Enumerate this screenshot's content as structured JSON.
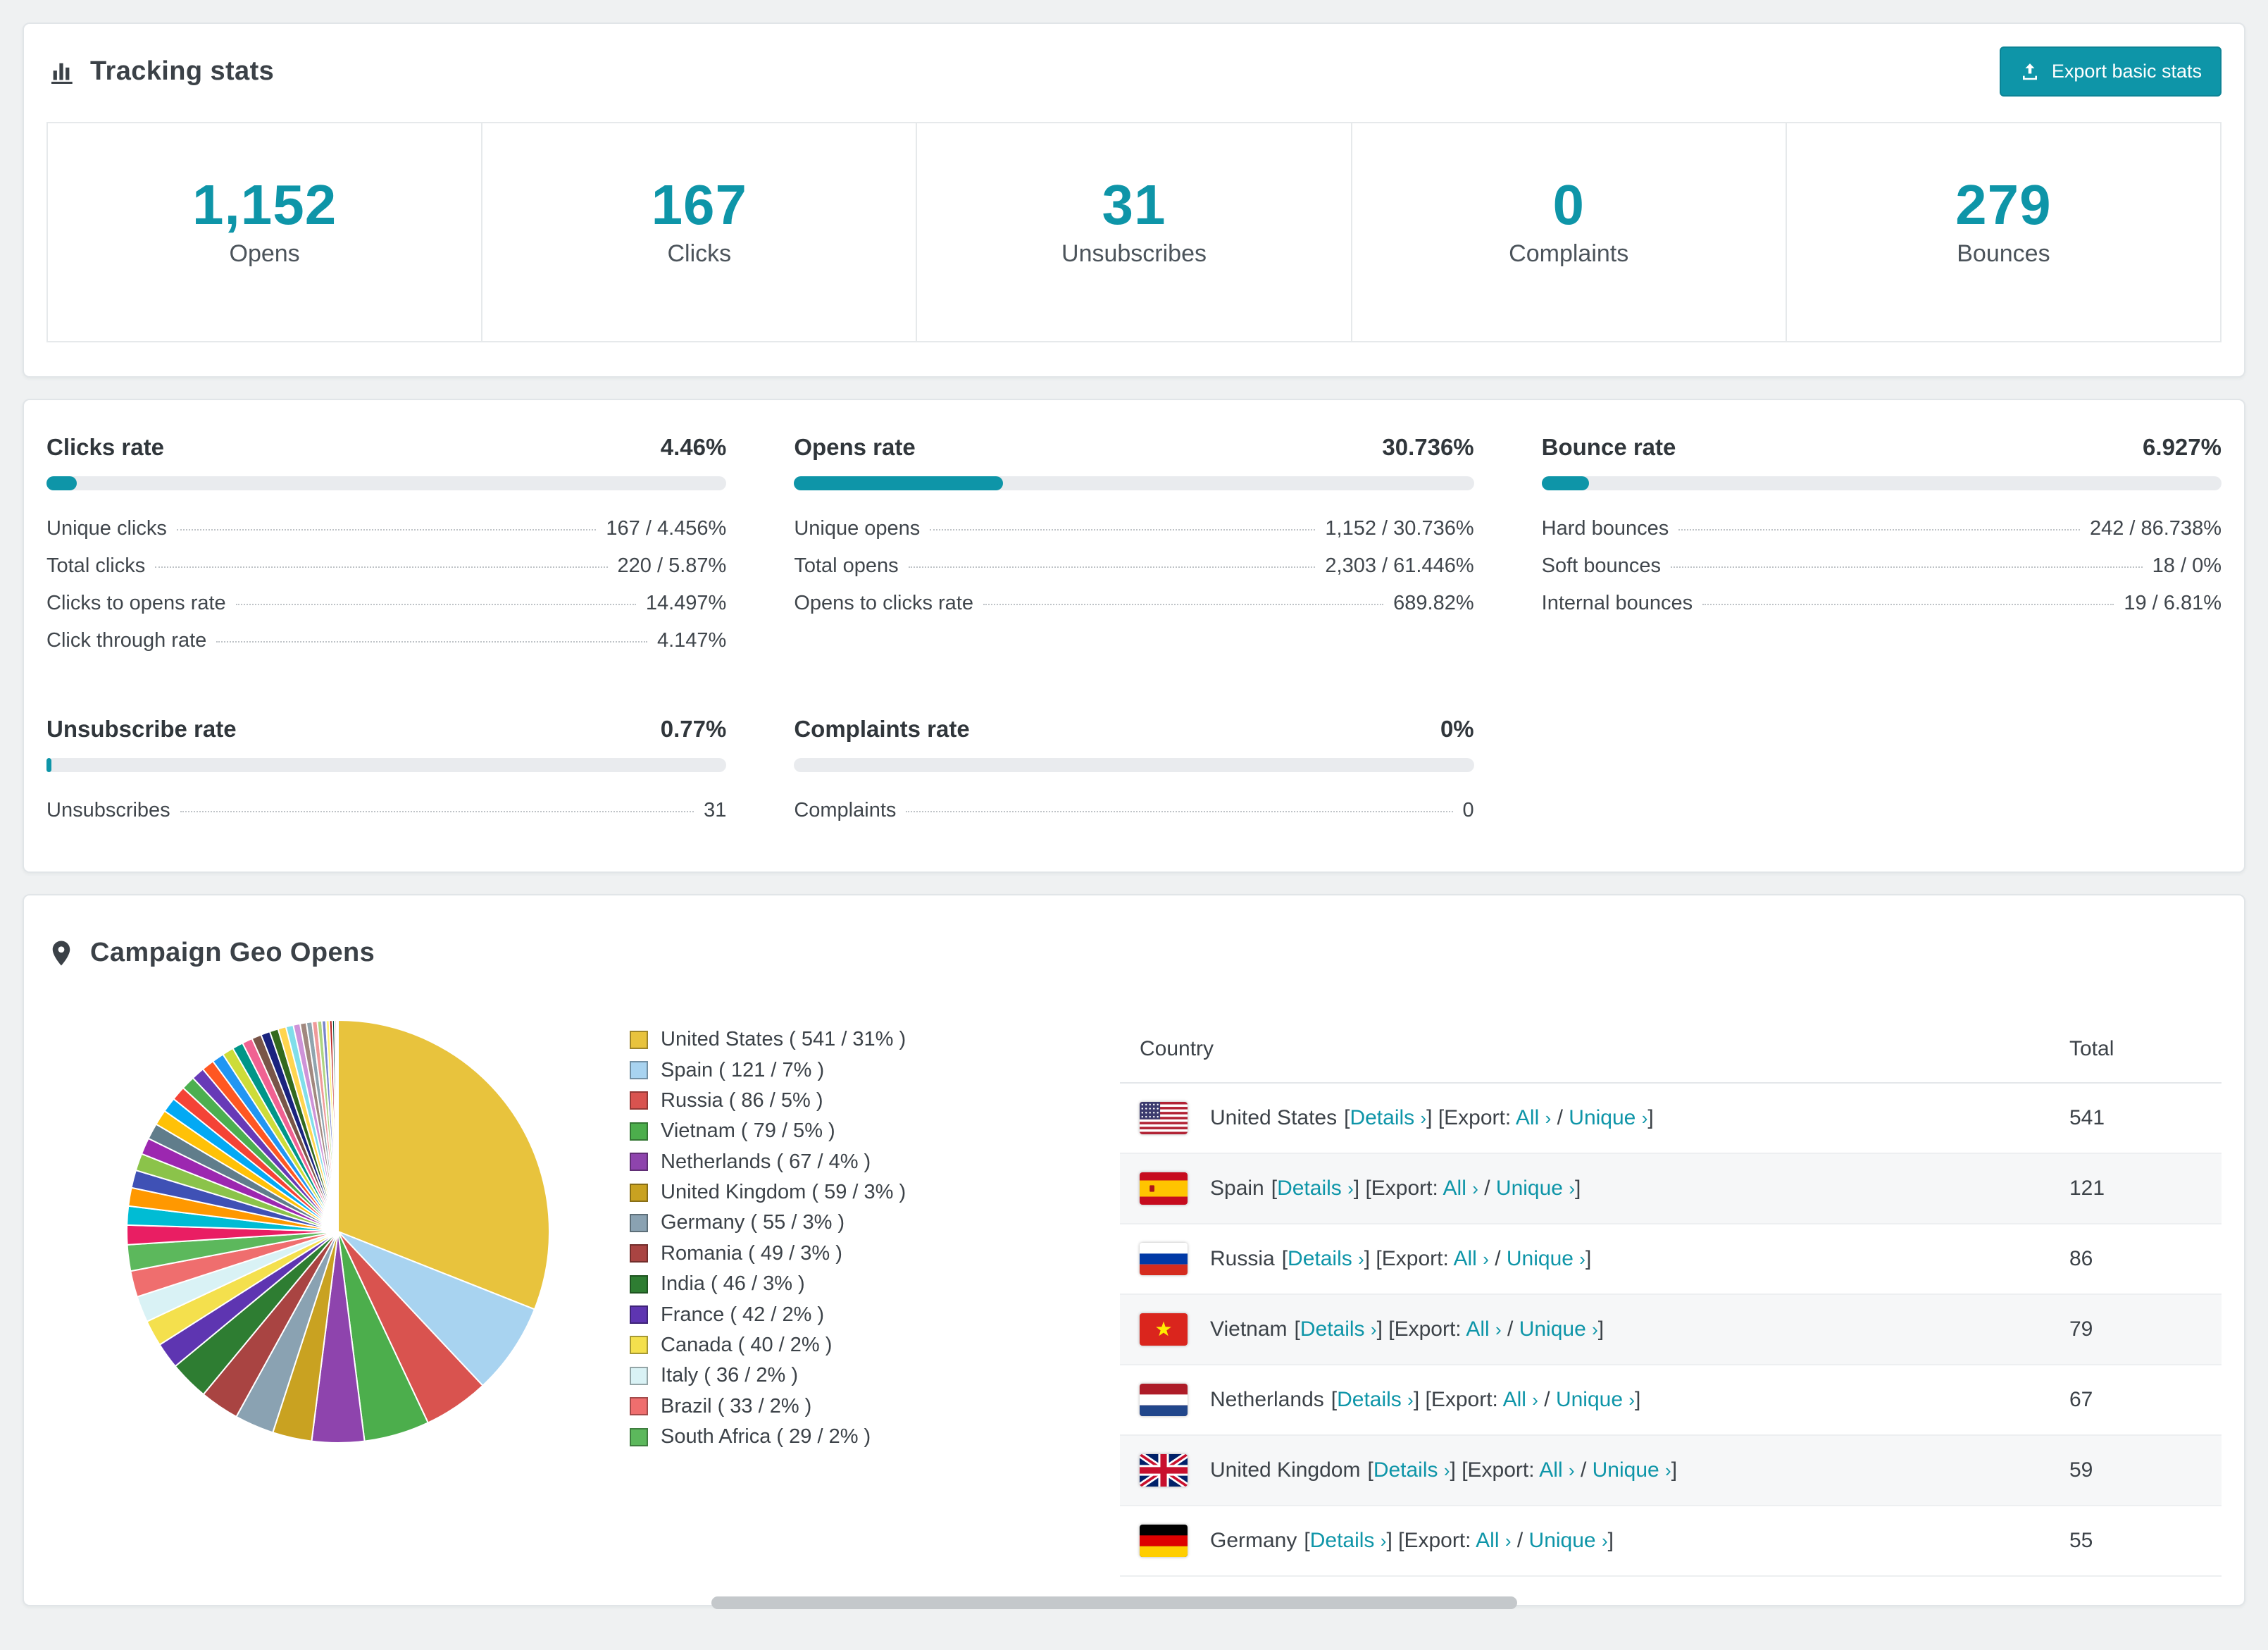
{
  "theme": {
    "accent": "#0e95a8",
    "accent_dark": "#0c8496",
    "page_background": "#eff1f2",
    "text_color": "#3c4248"
  },
  "tracking": {
    "title": "Tracking stats",
    "export_button": "Export basic stats",
    "stats": [
      {
        "value": "1,152",
        "label": "Opens"
      },
      {
        "value": "167",
        "label": "Clicks"
      },
      {
        "value": "31",
        "label": "Unsubscribes"
      },
      {
        "value": "0",
        "label": "Complaints"
      },
      {
        "value": "279",
        "label": "Bounces"
      }
    ]
  },
  "rates": [
    {
      "title": "Clicks rate",
      "value": "4.46%",
      "percent": 4.46,
      "rows": [
        {
          "label": "Unique clicks",
          "value": "167 / 4.456%"
        },
        {
          "label": "Total clicks",
          "value": "220 / 5.87%"
        },
        {
          "label": "Clicks to opens rate",
          "value": "14.497%"
        },
        {
          "label": "Click through rate",
          "value": "4.147%"
        }
      ]
    },
    {
      "title": "Opens rate",
      "value": "30.736%",
      "percent": 30.736,
      "rows": [
        {
          "label": "Unique opens",
          "value": "1,152 / 30.736%"
        },
        {
          "label": "Total opens",
          "value": "2,303 / 61.446%"
        },
        {
          "label": "Opens to clicks rate",
          "value": "689.82%"
        }
      ]
    },
    {
      "title": "Bounce rate",
      "value": "6.927%",
      "percent": 6.927,
      "rows": [
        {
          "label": "Hard bounces",
          "value": "242 / 86.738%"
        },
        {
          "label": "Soft bounces",
          "value": "18 / 0%"
        },
        {
          "label": "Internal bounces",
          "value": "19 / 6.81%"
        }
      ]
    },
    {
      "title": "Unsubscribe rate",
      "value": "0.77%",
      "percent": 0.77,
      "rows": [
        {
          "label": "Unsubscribes",
          "value": "31"
        }
      ]
    },
    {
      "title": "Complaints rate",
      "value": "0%",
      "percent": 0,
      "rows": [
        {
          "label": "Complaints",
          "value": "0"
        }
      ]
    }
  ],
  "geo": {
    "title": "Campaign Geo Opens",
    "table": {
      "headers": [
        "Country",
        "Total"
      ],
      "details_label": "Details",
      "export_prefix": "Export:",
      "all_label": "All",
      "unique_label": "Unique",
      "rows": [
        {
          "country": "United States",
          "flag": "us",
          "total": "541"
        },
        {
          "country": "Spain",
          "flag": "es",
          "total": "121"
        },
        {
          "country": "Russia",
          "flag": "ru",
          "total": "86"
        },
        {
          "country": "Vietnam",
          "flag": "vn",
          "total": "79"
        },
        {
          "country": "Netherlands",
          "flag": "nl",
          "total": "67"
        },
        {
          "country": "United Kingdom",
          "flag": "gb",
          "total": "59"
        },
        {
          "country": "Germany",
          "flag": "de",
          "total": "55"
        }
      ]
    }
  },
  "chart_data": {
    "type": "pie",
    "title": "Campaign Geo Opens",
    "legend_position": "right",
    "series": [
      {
        "label": "United States",
        "value": 541,
        "percent": 31,
        "color": "#e8c33d"
      },
      {
        "label": "Spain",
        "value": 121,
        "percent": 7,
        "color": "#a8d3f0"
      },
      {
        "label": "Russia",
        "value": 86,
        "percent": 5,
        "color": "#d9534f"
      },
      {
        "label": "Vietnam",
        "value": 79,
        "percent": 5,
        "color": "#4cae4c"
      },
      {
        "label": "Netherlands",
        "value": 67,
        "percent": 4,
        "color": "#8e44ad"
      },
      {
        "label": "United Kingdom",
        "value": 59,
        "percent": 3,
        "color": "#c9a221"
      },
      {
        "label": "Germany",
        "value": 55,
        "percent": 3,
        "color": "#8aa2b2"
      },
      {
        "label": "Romania",
        "value": 49,
        "percent": 3,
        "color": "#a94442"
      },
      {
        "label": "India",
        "value": 46,
        "percent": 3,
        "color": "#2e7d32"
      },
      {
        "label": "France",
        "value": 42,
        "percent": 2,
        "color": "#5e35b1"
      },
      {
        "label": "Canada",
        "value": 40,
        "percent": 2,
        "color": "#f4e04d"
      },
      {
        "label": "Italy",
        "value": 36,
        "percent": 2,
        "color": "#d9f2f5"
      },
      {
        "label": "Brazil",
        "value": 33,
        "percent": 2,
        "color": "#ef6e6e"
      },
      {
        "label": "South Africa",
        "value": 29,
        "percent": 2,
        "color": "#5cb85c"
      }
    ],
    "others_percent": 26,
    "others_slice_count": 34,
    "others_palette": [
      "#e91e63",
      "#00bcd4",
      "#ff9800",
      "#3f51b5",
      "#8bc34a",
      "#9c27b0",
      "#607d8b",
      "#ffc107",
      "#03a9f4",
      "#f44336",
      "#4caf50",
      "#673ab7",
      "#ff5722",
      "#2196f3",
      "#cddc39",
      "#009688",
      "#f06292",
      "#795548",
      "#1a237e",
      "#33691e",
      "#ffd54f",
      "#80deea",
      "#ce93d8",
      "#a1887f",
      "#90a4ae",
      "#ef9a9a",
      "#aed581",
      "#7986cb",
      "#fff176",
      "#b71c1c",
      "#004d40",
      "#f48fb1",
      "#c0ca33",
      "#5d4037"
    ]
  }
}
